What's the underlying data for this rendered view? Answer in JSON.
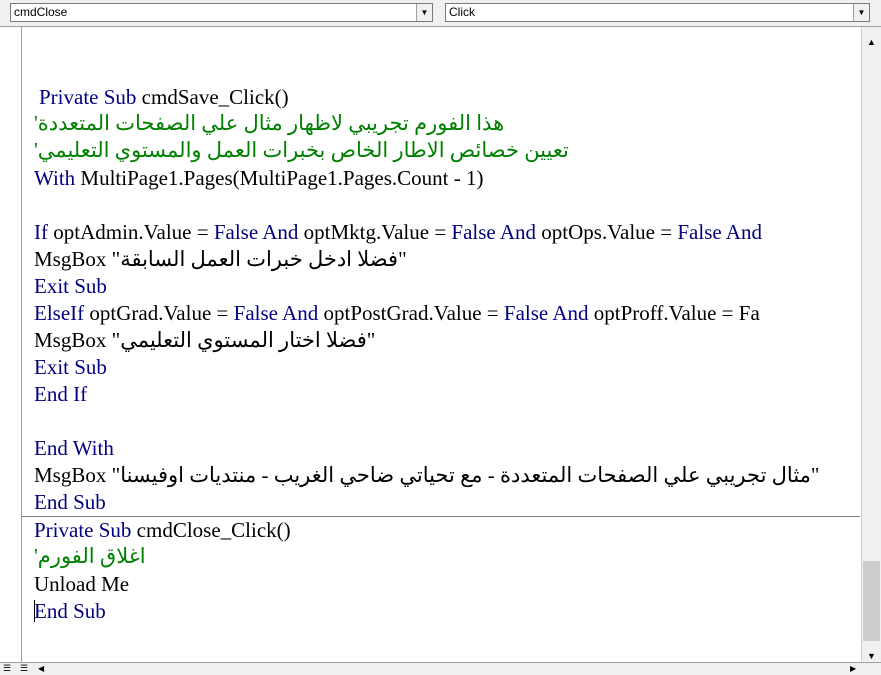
{
  "object_combo": {
    "value": "cmdClose"
  },
  "procedure_combo": {
    "value": "Click"
  },
  "code": {
    "save_sub": {
      "l1_kw": "Private Sub",
      "l1_txt": " cmdSave_Click()",
      "l2_comment": "'هذا الفورم تجريبي لاظهار مثال علي الصفحات المتعددة",
      "l3_comment": "'تعيين خصائص الاطار الخاص بخبرات العمل والمستوي التعليمي",
      "l4_kw": "With",
      "l4_txt": " MultiPage1.Pages(MultiPage1.Pages.Count - 1)",
      "l5_a": "If",
      "l5_b": " optAdmin.Value = ",
      "l5_c": "False And",
      "l5_d": " optMktg.Value = ",
      "l5_e": "False And",
      "l5_f": " optOps.Value = ",
      "l5_g": "False And",
      "l6_txt": "MsgBox \"فضلا ادخل خبرات العمل السابقة\"",
      "l7_kw": "Exit Sub",
      "l8_a": "ElseIf",
      "l8_b": " optGrad.Value = ",
      "l8_c": "False And",
      "l8_d": " optPostGrad.Value = ",
      "l8_e": "False And",
      "l8_f": " optProff.Value = Fa",
      "l9_txt": "MsgBox \"فضلا اختار المستوي التعليمي\"",
      "l10_kw": "Exit Sub",
      "l11_kw": "End If",
      "l12_kw": "End With",
      "l13_txt": "MsgBox \"مثال تجريبي علي الصفحات المتعددة - مع تحياتي ضاحي الغريب - منتديات اوفيسنا\"",
      "l14_kw": "End Sub"
    },
    "close_sub": {
      "l1_kw": "Private Sub",
      "l1_txt": " cmdClose_Click()",
      "l2_comment": "'اغلاق الفورم",
      "l3_txt": "Unload Me",
      "l4_kw": "End Sub"
    }
  },
  "icons": {
    "dropdown": "chevron-down-icon",
    "scroll_up": "arrow-up-icon",
    "scroll_down": "arrow-down-icon"
  }
}
